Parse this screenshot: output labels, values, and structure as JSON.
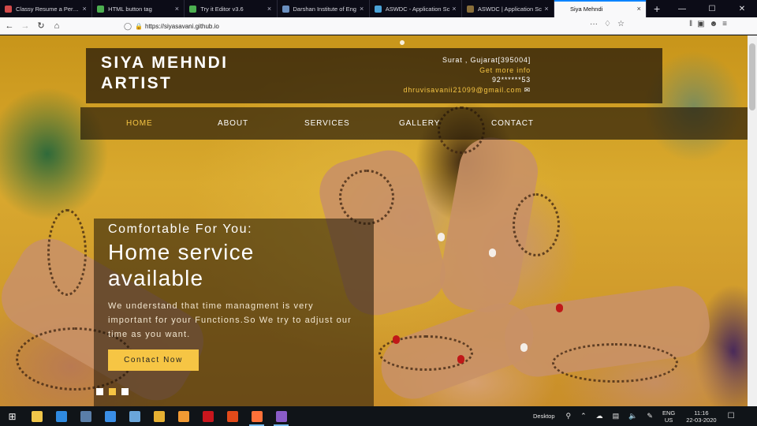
{
  "browser": {
    "tabs": [
      {
        "title": "Classy Resume a Person",
        "favicon_color": "#d24a4a",
        "active": false
      },
      {
        "title": "HTML button tag",
        "favicon_color": "#4caf50",
        "active": false
      },
      {
        "title": "Try it Editor v3.6",
        "favicon_color": "#4caf50",
        "active": false
      },
      {
        "title": "Darshan Institute of Eng",
        "favicon_color": "#6a8fbf",
        "active": false
      },
      {
        "title": "ASWDC - Application Sc",
        "favicon_color": "#4aa3d8",
        "active": false
      },
      {
        "title": "ASWDC | Application Sc",
        "favicon_color": "#8a6f3a",
        "active": false
      },
      {
        "title": "Siya Mehndi",
        "favicon_color": "#f9f9fa",
        "active": true
      }
    ],
    "new_tab_glyph": "+",
    "window_controls": {
      "minimize": "—",
      "maximize": "☐",
      "close": "✕"
    },
    "url": "https://siyasavani.github.io",
    "icons": {
      "back": "back-arrow-icon",
      "forward": "forward-arrow-icon",
      "reload": "reload-icon",
      "home": "home-icon"
    }
  },
  "site": {
    "brand_line1": "SIYA MEHNDI",
    "brand_line2": "ARTIST",
    "location": "Surat , Gujarat[395004]",
    "get_more_info": "Get more info",
    "phone": "92******53",
    "email": "dhruvisavanii21099@gmail.com",
    "menu": [
      {
        "label": "HOME",
        "active": true
      },
      {
        "label": "ABOUT",
        "active": false
      },
      {
        "label": "SERVICES",
        "active": false
      },
      {
        "label": "GALLERY",
        "active": false
      },
      {
        "label": "CONTACT",
        "active": false
      }
    ],
    "hero": {
      "subtitle": "Comfortable For You:",
      "title_line1": "Home service",
      "title_line2": "available",
      "text": "We understand that time managment is very important for your Functions.So We try to adjust our time as you want.",
      "button": "Contact Now"
    },
    "accent_color": "#f6c544"
  },
  "taskbar": {
    "apps": [
      {
        "name": "file-explorer-icon",
        "color": "#f0c64a",
        "open": false
      },
      {
        "name": "edge-icon",
        "color": "#2f8ae0",
        "open": false
      },
      {
        "name": "store-icon",
        "color": "#5a7ea8",
        "open": false
      },
      {
        "name": "mail-icon",
        "color": "#3a8ee6",
        "open": false
      },
      {
        "name": "contacts-icon",
        "color": "#6aa6da",
        "open": false
      },
      {
        "name": "chrome-icon",
        "color": "#e7b132",
        "open": false
      },
      {
        "name": "sublime-icon",
        "color": "#f29a33",
        "open": false
      },
      {
        "name": "netflix-icon",
        "color": "#c8161d",
        "open": false
      },
      {
        "name": "office-icon",
        "color": "#e24a1a",
        "open": false
      },
      {
        "name": "firefox-icon",
        "color": "#ff7139",
        "open": true
      },
      {
        "name": "github-icon",
        "color": "#8a5cc7",
        "open": true
      }
    ],
    "desktop_label": "Desktop",
    "lang_top": "ENG",
    "lang_bottom": "US",
    "time": "11:16",
    "date": "22-03-2020"
  }
}
